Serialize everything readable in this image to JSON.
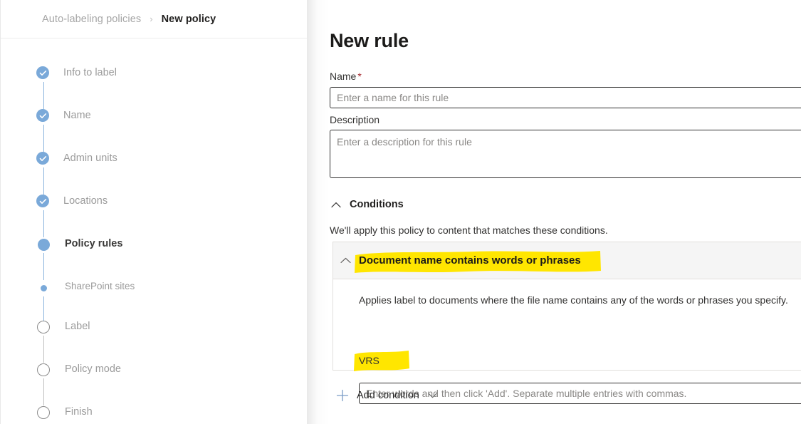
{
  "breadcrumb": {
    "parent": "Auto-labeling policies",
    "separator": "›",
    "current": "New policy"
  },
  "wizard": {
    "steps": [
      {
        "label": "Info to label",
        "state": "done",
        "icon": "check-circle-icon"
      },
      {
        "label": "Name",
        "state": "done",
        "icon": "check-circle-icon"
      },
      {
        "label": "Admin units",
        "state": "done",
        "icon": "check-circle-icon"
      },
      {
        "label": "Locations",
        "state": "done",
        "icon": "check-circle-icon"
      },
      {
        "label": "Policy rules",
        "state": "current",
        "icon": "filled-dot-icon"
      },
      {
        "label": "SharePoint sites",
        "state": "sub",
        "icon": "small-dot-icon"
      },
      {
        "label": "Label",
        "state": "pending",
        "icon": "empty-circle-icon"
      },
      {
        "label": "Policy mode",
        "state": "pending",
        "icon": "empty-circle-icon"
      },
      {
        "label": "Finish",
        "state": "pending",
        "icon": "empty-circle-icon"
      }
    ]
  },
  "panel": {
    "title": "New rule",
    "name_label": "Name",
    "name_required_marker": "*",
    "name_value": "",
    "name_placeholder": "Enter a name for this rule",
    "description_label": "Description",
    "description_value": "",
    "description_placeholder": "Enter a description for this rule"
  },
  "conditions": {
    "section_title": "Conditions",
    "collapse_icon": "chevron-up-icon",
    "intro": "We'll apply this policy to content that matches these conditions.",
    "card": {
      "collapse_icon": "chevron-up-icon",
      "title": "Document name contains words or phrases",
      "title_highlighted": true,
      "applies_text": "Applies label to documents where the file name contains any of the words or phrases you specify.",
      "tag": "VRS",
      "tag_highlighted": true,
      "words_value": "",
      "words_placeholder": "Enter words and then click 'Add'. Separate multiple entries with commas."
    },
    "add_condition": {
      "plus_icon": "plus-icon",
      "label": "Add condition",
      "chevron_icon": "chevron-down-icon"
    }
  },
  "colors": {
    "accent_blue": "#7aa9d9",
    "highlight_yellow": "#FFE600",
    "required_red": "#a4262c",
    "text_primary": "#323130",
    "text_muted": "#9b9b9b",
    "card_header_bg": "#f5f5f5",
    "border": "#e1dfdd"
  }
}
